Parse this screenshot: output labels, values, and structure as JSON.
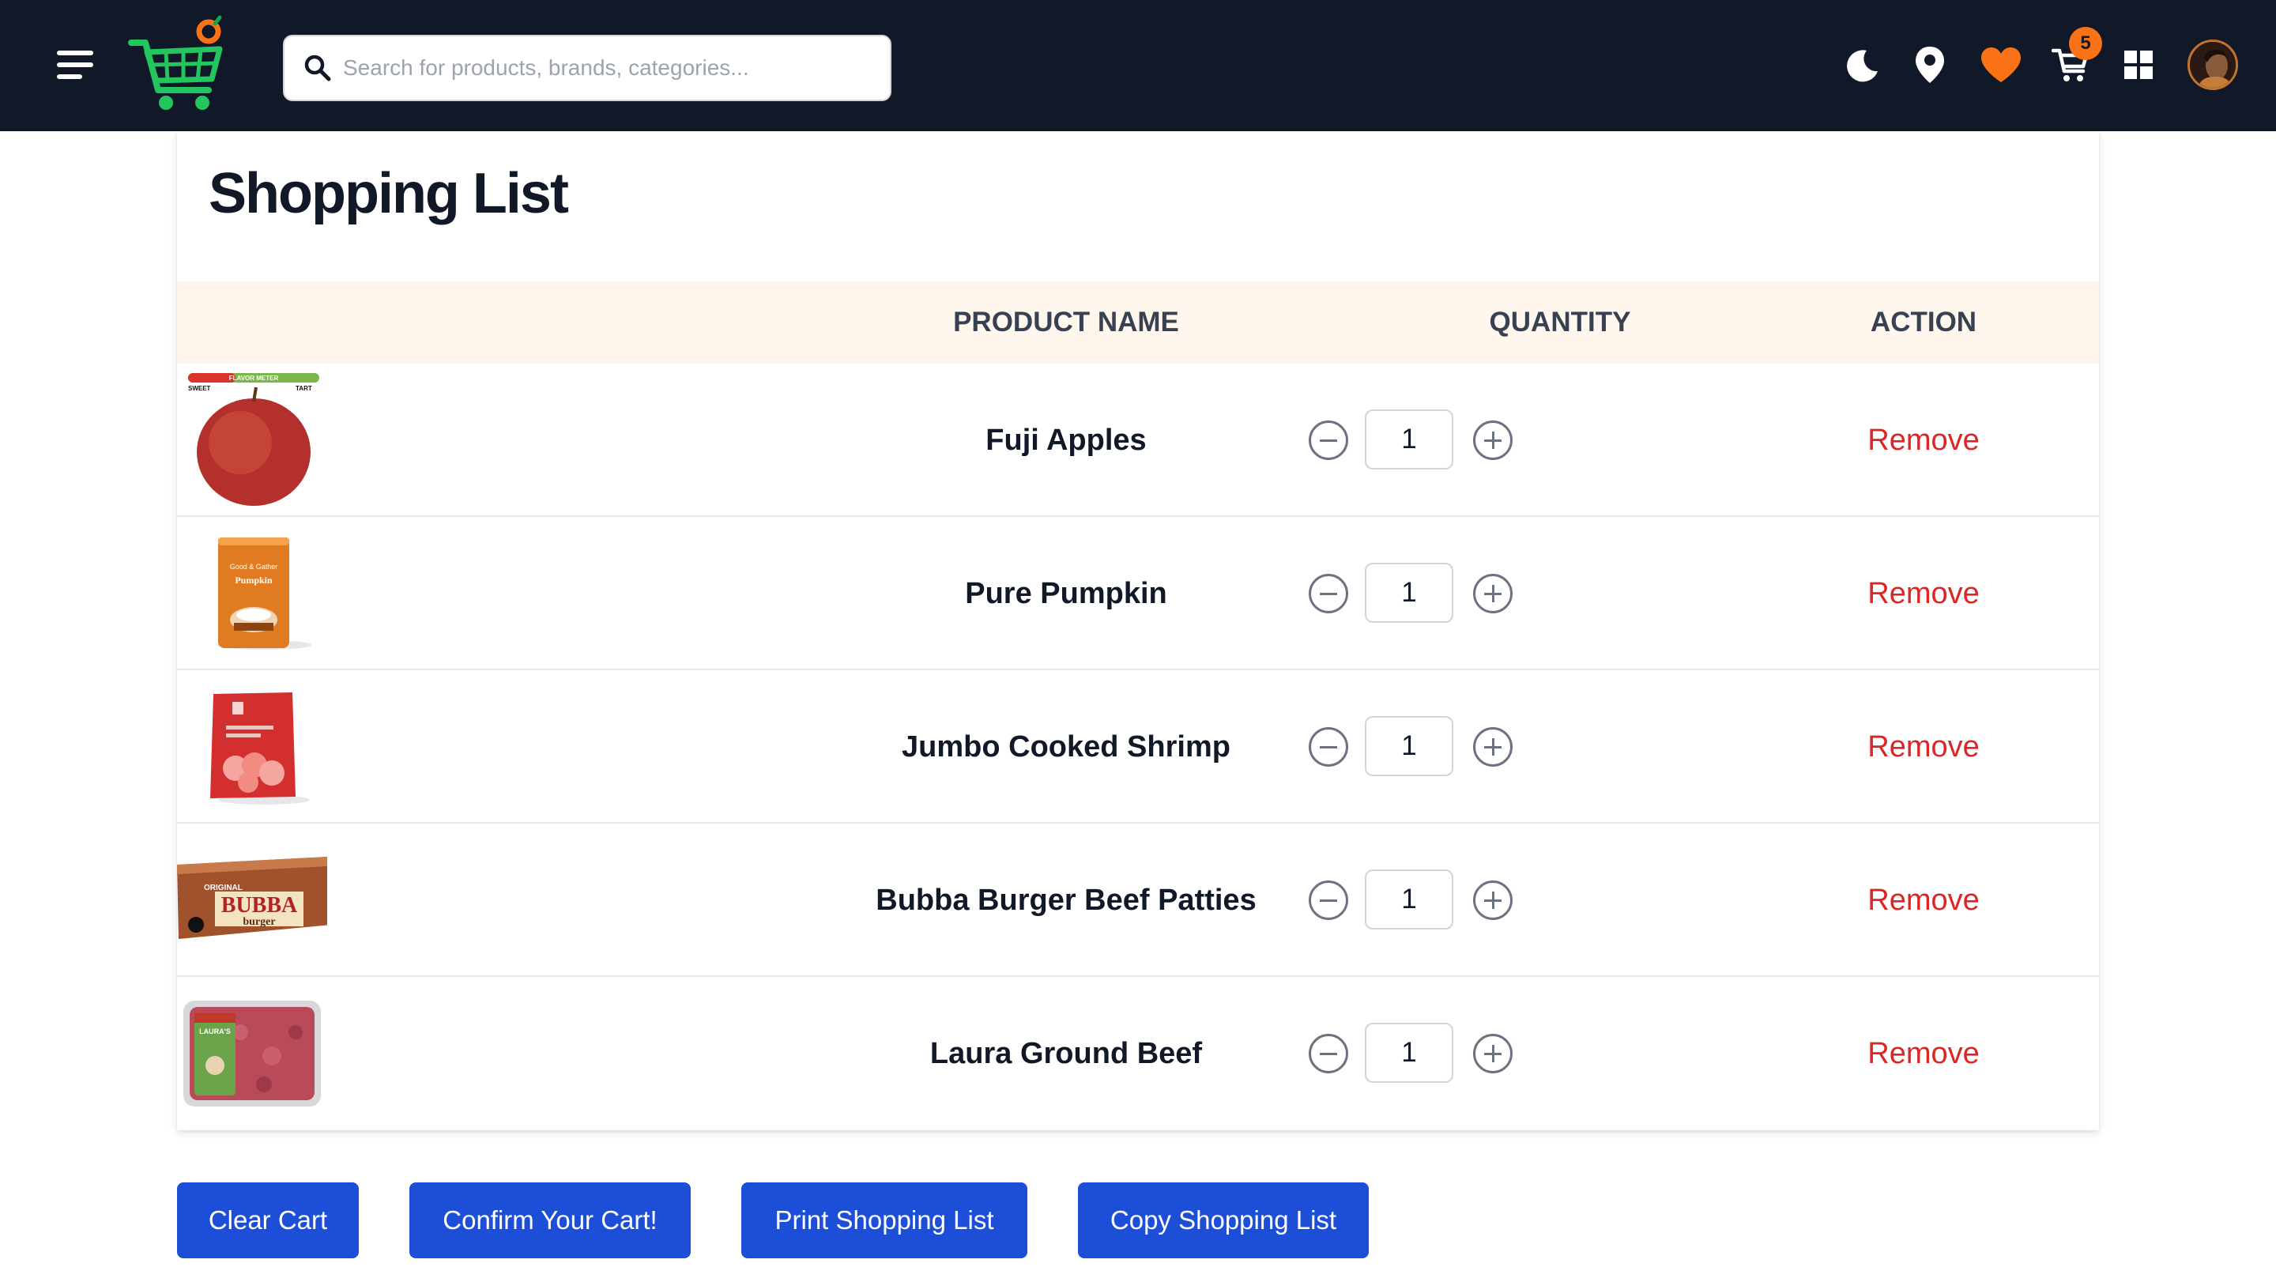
{
  "search": {
    "placeholder": "Search for products, brands, categories..."
  },
  "header": {
    "cart_count": "5",
    "icons": [
      "menu-icon",
      "cart-logo",
      "search-icon",
      "moon-icon",
      "location-pin-icon",
      "heart-icon",
      "cart-icon",
      "grid-icon",
      "avatar"
    ]
  },
  "colors": {
    "navbar": "#111827",
    "accent_orange": "#f97316",
    "table_header_bg": "#fff7ed",
    "remove_red": "#dc2626",
    "button_blue": "#1d4ed8"
  },
  "page": {
    "title": "Shopping List"
  },
  "table": {
    "headers": [
      "PRODUCT NAME",
      "QUANTITY",
      "ACTION"
    ],
    "rows": [
      {
        "name": "Fuji Apples",
        "quantity": "1",
        "action": "Remove",
        "image": "apple"
      },
      {
        "name": "Pure Pumpkin",
        "quantity": "1",
        "action": "Remove",
        "image": "pumpkin-can"
      },
      {
        "name": "Jumbo Cooked Shrimp",
        "quantity": "1",
        "action": "Remove",
        "image": "shrimp-bag"
      },
      {
        "name": "Bubba Burger Beef Patties",
        "quantity": "1",
        "action": "Remove",
        "image": "burger-box"
      },
      {
        "name": "Laura Ground Beef",
        "quantity": "1",
        "action": "Remove",
        "image": "ground-beef"
      }
    ]
  },
  "product_images": {
    "apple": {
      "meter": "FLAVOR METER",
      "left": "SWEET",
      "right": "TART"
    },
    "pumpkin": {
      "brand": "Good & Gather",
      "label": "Pumpkin"
    },
    "burger": {
      "top": "ORIGINAL",
      "brand": "BUBBA",
      "sub": "burger"
    },
    "beef": {
      "brand": "LAURA'S"
    }
  },
  "actions": {
    "clear": "Clear Cart",
    "confirm": "Confirm Your Cart!",
    "print": "Print Shopping List",
    "copy": "Copy Shopping List"
  }
}
